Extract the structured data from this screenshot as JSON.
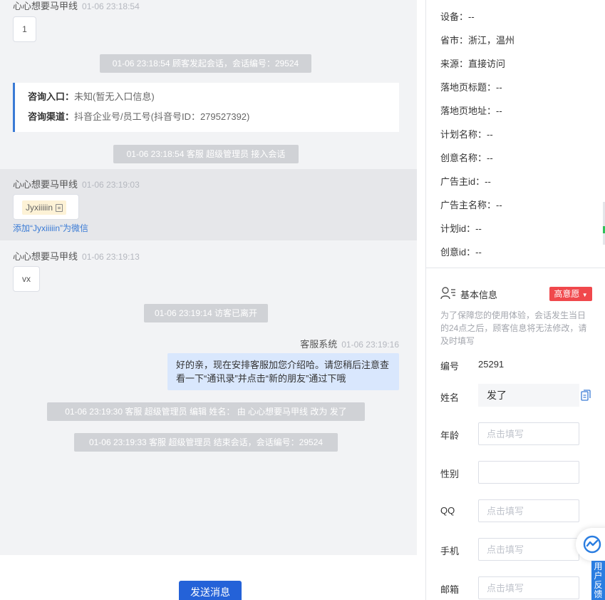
{
  "chat": {
    "m1": {
      "name": "心心想要马甲线",
      "time": "01-06 23:18:54",
      "text": "1"
    },
    "sys1": "01-06 23:18:54 顾客发起会话，会话编号：29524",
    "info": {
      "entry_key": "咨询入口：",
      "entry_val": "未知(暂无入口信息)",
      "channel_key": "咨询渠道：",
      "channel_val": "抖音企业号/员工号(抖音号ID：279527392)"
    },
    "sys2": "01-06 23:18:54 客服 超级管理员 接入会话",
    "m2": {
      "name": "心心想要马甲线",
      "time": "01-06 23:19:03",
      "wechat": "Jyxiiiiin",
      "link": "添加“Jyxiiiiin”为微信"
    },
    "m3": {
      "name": "心心想要马甲线",
      "time": "01-06 23:19:13",
      "text": "vx"
    },
    "sys3": "01-06 23:19:14 访客已离开",
    "agent": {
      "name": "客服系统",
      "time": "01-06 23:19:16",
      "text": "好的亲，现在安排客服加您介绍哈。请您稍后注意查看一下“通讯录”并点击“新的朋友”通过下哦"
    },
    "sys4": "01-06 23:19:30 客服 超级管理员 编辑 姓名： 由 心心想要马甲线 改为 发了",
    "sys5": "01-06 23:19:33 客服 超级管理员 结束会话，会话编号：29524",
    "send_label": "发送消息"
  },
  "tracking": [
    "设备：--",
    "省市：浙江，温州",
    "来源：直接访问",
    "落地页标题：--",
    "落地页地址：--",
    "计划名称：--",
    "创意名称：--",
    "广告主id：--",
    "广告主名称：--",
    "计划id：--",
    "创意id：--"
  ],
  "basic": {
    "title": "基本信息",
    "intent": "高意愿",
    "notice": "为了保障您的使用体验，会话发生当日的24点之后，顾客信息将无法修改，请及时填写",
    "id_label": "编号",
    "id_value": "25291",
    "name_label": "姓名",
    "name_value": "发了",
    "age_label": "年龄",
    "gender_label": "性别",
    "qq_label": "QQ",
    "phone_label": "手机",
    "email_label": "邮箱",
    "placeholder": "点击填写"
  },
  "feedback_label": "用户反馈",
  "colors": {
    "primary": "#2462d8",
    "accent": "#3a7bd5",
    "badge": "#f0484c",
    "agent_bubble": "#d9e7fd"
  }
}
